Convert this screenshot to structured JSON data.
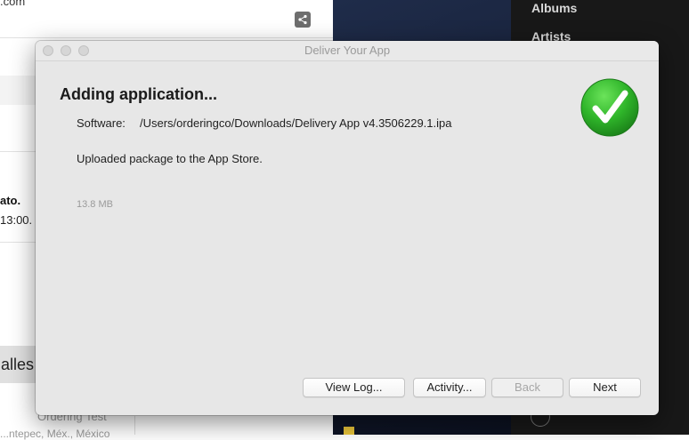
{
  "background": {
    "left_app": {
      "top_text": ".com",
      "bold_fragment": "ato.",
      "time_fragment": "13:00.",
      "detalles_fragment": "alles",
      "ordering_text": "Ordering Test",
      "location_text": "...ntepec, Méx., México"
    },
    "sidebar": {
      "items": [
        {
          "label": "Albums"
        },
        {
          "label": "Artists"
        }
      ]
    }
  },
  "dialog": {
    "title": "Deliver Your App",
    "heading": "Adding application...",
    "software_label": "Software:",
    "software_path": "/Users/orderingco/Downloads/Delivery App v4.3506229.1.ipa",
    "status_message": "Uploaded package to the App Store.",
    "size": "13.8 MB",
    "status_icon": "checkmark-success-icon",
    "buttons": {
      "view_log": "View Log...",
      "activity": "Activity...",
      "back": "Back",
      "next": "Next"
    }
  },
  "colors": {
    "success_green": "#2fb52a",
    "dialog_bg": "#e7e7e7",
    "sidebar_bg": "#181818"
  }
}
